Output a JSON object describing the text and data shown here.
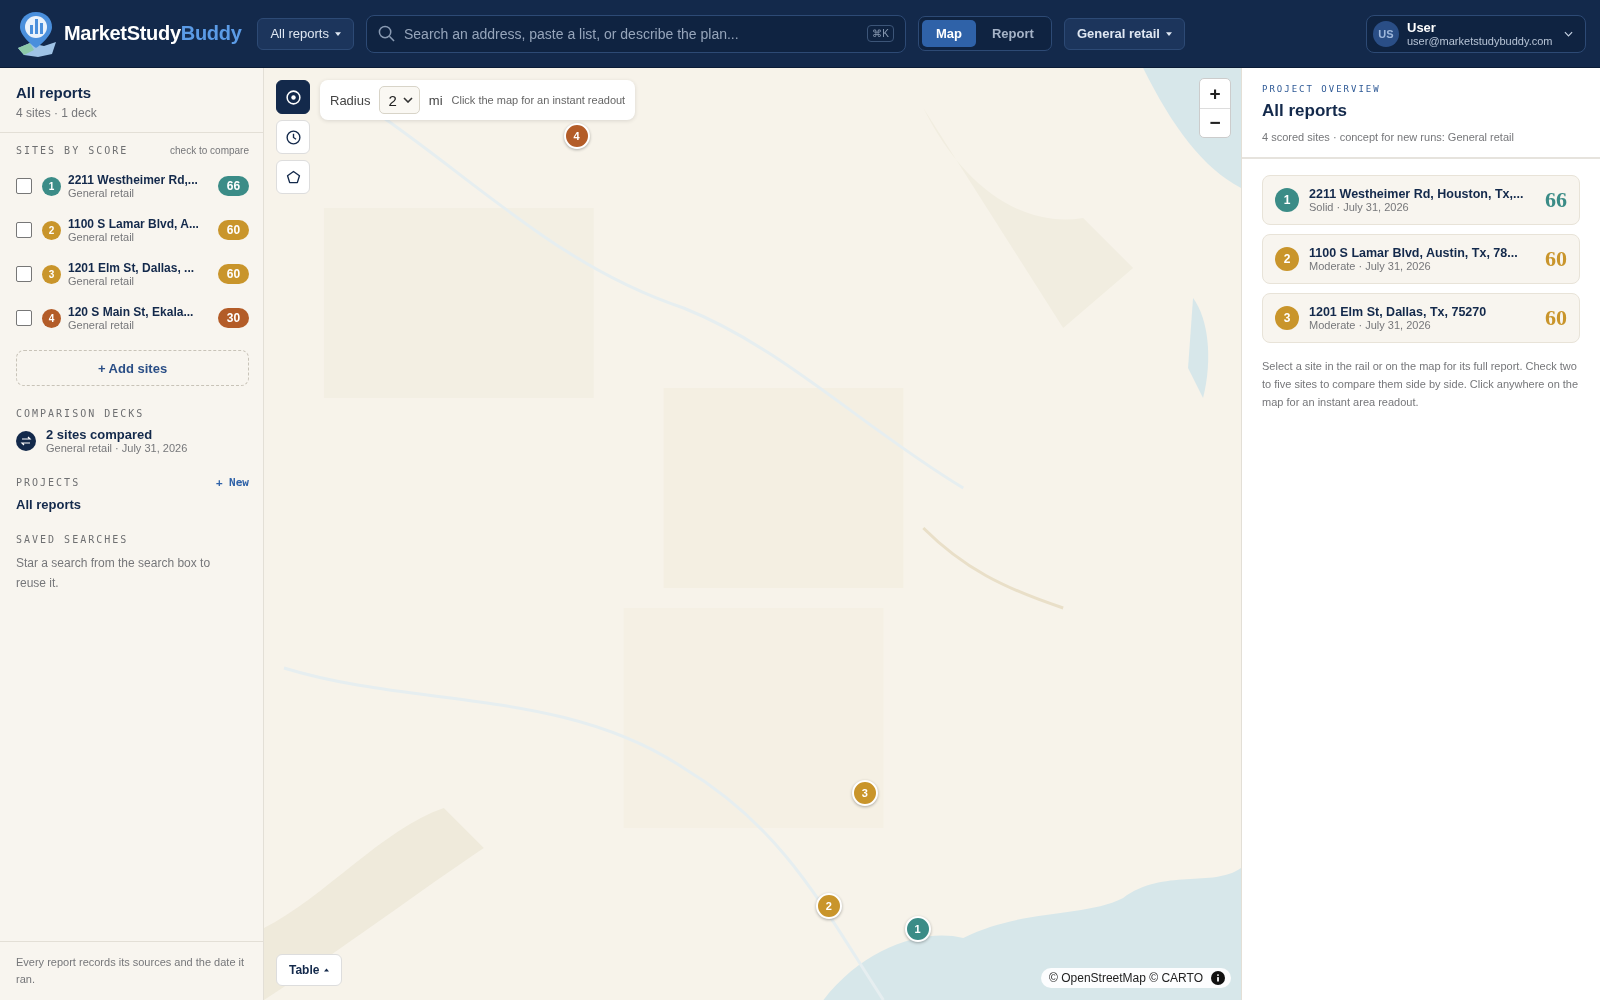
{
  "header": {
    "logo": {
      "part1": "MarketStudy",
      "part2": "Buddy"
    },
    "scope": "All reports",
    "search": {
      "placeholder": "Search an address, paste a list, or describe the plan...",
      "shortcut": "⌘K"
    },
    "view_tabs": [
      {
        "label": "Map",
        "selected": true
      },
      {
        "label": "Report",
        "selected": false
      }
    ],
    "concept": "General retail",
    "user": {
      "initials": "US",
      "name": "User",
      "email": "user@marketstudybuddy.com"
    }
  },
  "sidebar": {
    "title": "All reports",
    "subtitle": "4 sites · 1 deck",
    "sites_heading": "SITES BY SCORE",
    "sites_hint": "check to compare",
    "sites": [
      {
        "rank": "1",
        "address": "2211 Westheimer Rd,...",
        "concept": "General retail",
        "score": "66",
        "color": "#3b8c87",
        "checked": false
      },
      {
        "rank": "2",
        "address": "1100 S Lamar Blvd, A...",
        "concept": "General retail",
        "score": "60",
        "color": "#c9952b",
        "checked": false
      },
      {
        "rank": "3",
        "address": "1201 Elm St, Dallas, ...",
        "concept": "General retail",
        "score": "60",
        "color": "#c9952b",
        "checked": false
      },
      {
        "rank": "4",
        "address": "120 S Main St, Ekala...",
        "concept": "General retail",
        "score": "30",
        "color": "#b35c28",
        "checked": false
      }
    ],
    "add_sites": "+ Add sites",
    "decks_heading": "COMPARISON DECKS",
    "decks": [
      {
        "title": "2 sites compared",
        "subtitle": "General retail · July 31, 2026"
      }
    ],
    "projects_heading": "PROJECTS",
    "new_project": "+ New",
    "projects": [
      {
        "label": "All reports"
      }
    ],
    "saved_heading": "SAVED SEARCHES",
    "saved_empty": "Star a search from the search box to reuse it.",
    "footer": "Every report records its sources and the date it ran."
  },
  "map": {
    "tools": [
      {
        "kind": "readout",
        "selected": true
      },
      {
        "kind": "history",
        "selected": false
      },
      {
        "kind": "polygon",
        "selected": false
      }
    ],
    "radius": {
      "label": "Radius",
      "value": "2",
      "unit": "mi",
      "hint": "Click the map for an instant readout"
    },
    "markers": [
      {
        "label": "4",
        "color": "#b35c28"
      },
      {
        "label": "3",
        "color": "#c9952b"
      },
      {
        "label": "2",
        "color": "#c9952b"
      },
      {
        "label": "1",
        "color": "#3b8c87"
      }
    ],
    "zoom_in": "+",
    "zoom_out": "−",
    "table_button": "Table",
    "attribution": "© OpenStreetMap © CARTO"
  },
  "panel": {
    "eyebrow": "PROJECT OVERVIEW",
    "title": "All reports",
    "subtitle": "4 scored sites · concept for new runs: General retail",
    "cards": [
      {
        "rank": "1",
        "address": "2211 Westheimer Rd, Houston, Tx,...",
        "meta": "Solid · July 31, 2026",
        "score": "66",
        "color": "#3b8c87"
      },
      {
        "rank": "2",
        "address": "1100 S Lamar Blvd, Austin, Tx, 78...",
        "meta": "Moderate · July 31, 2026",
        "score": "60",
        "color": "#c9952b"
      },
      {
        "rank": "3",
        "address": "1201 Elm St, Dallas, Tx, 75270",
        "meta": "Moderate · July 31, 2026",
        "score": "60",
        "color": "#c9952b"
      }
    ],
    "help": "Select a site in the rail or on the map for its full report. Check two to five sites to compare them side by side. Click anywhere on the map for an instant area readout."
  }
}
